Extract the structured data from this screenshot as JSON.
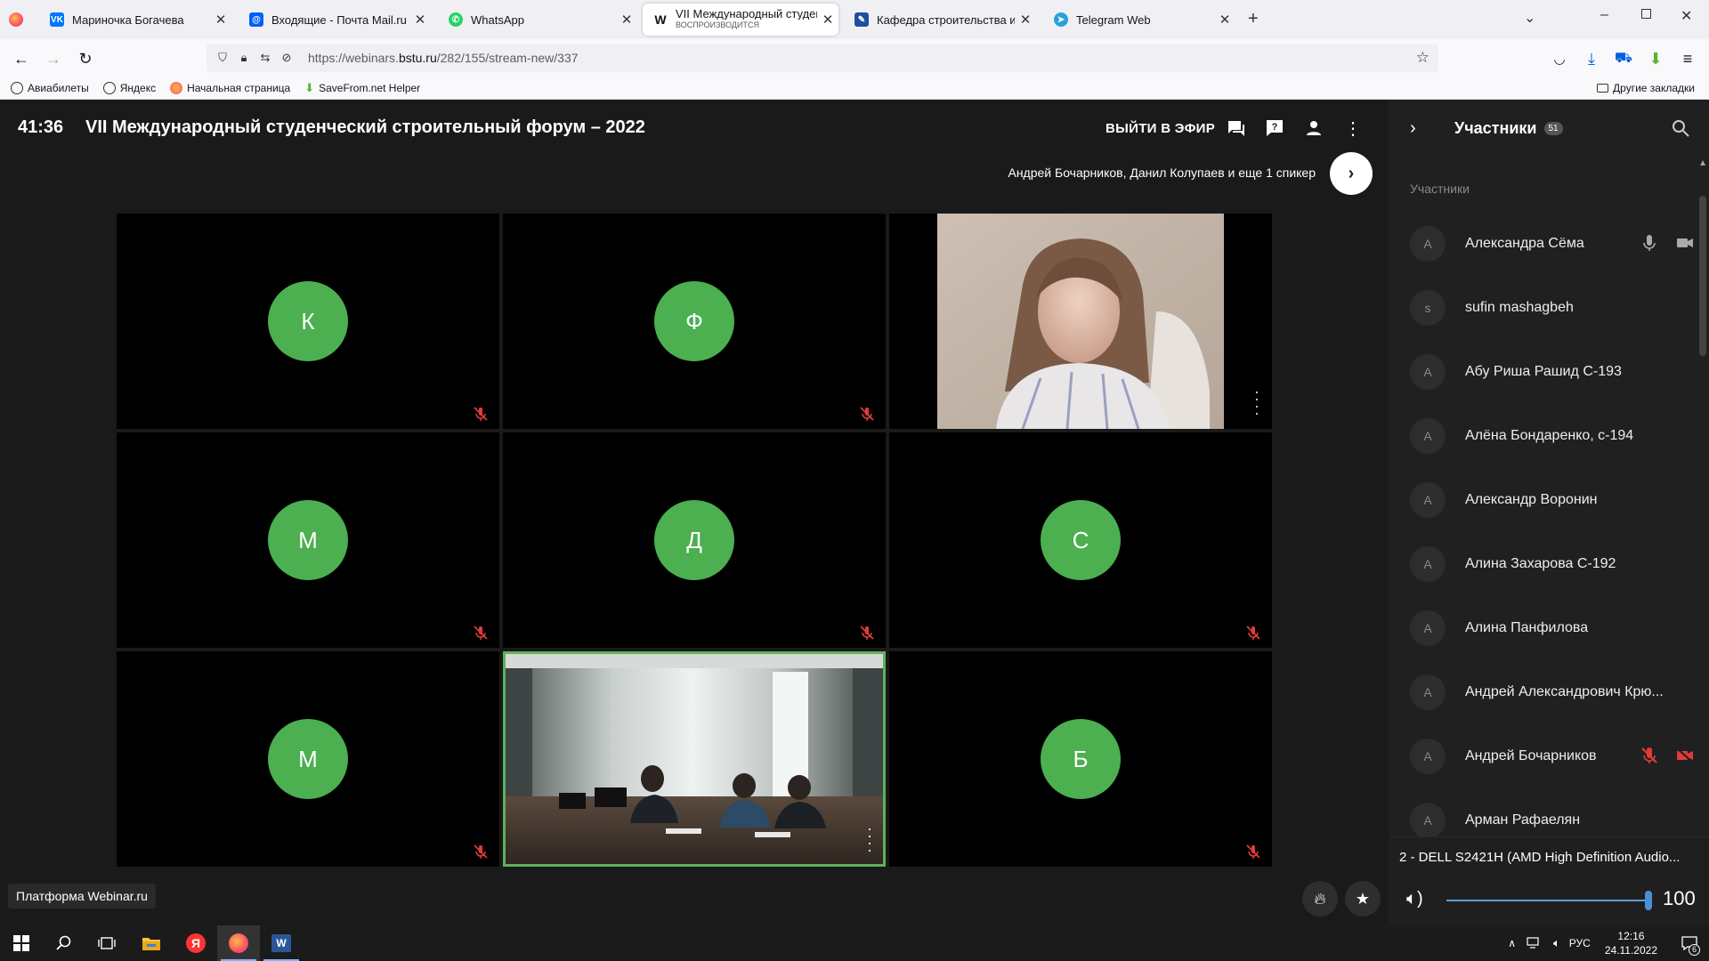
{
  "browser": {
    "tabs": [
      {
        "title": "Мариночка Богачева",
        "icon": "vk-icon",
        "color": "#0077ff"
      },
      {
        "title": "Входящие - Почта Mail.ru",
        "icon": "mail-icon",
        "color": "#005ff9"
      },
      {
        "title": "WhatsApp",
        "icon": "whatsapp-icon",
        "color": "#25d366"
      },
      {
        "title": "VII Международный студенчес",
        "subtitle": "ВОСПРОИЗВОДИТСЯ",
        "icon": "webinar-icon",
        "color": "#222222"
      },
      {
        "title": "Кафедра строительства и горо",
        "icon": "site-icon",
        "color": "#1d4fa0"
      },
      {
        "title": "Telegram Web",
        "icon": "telegram-icon",
        "color": "#2aa1da"
      }
    ],
    "url_prefix": "https://webinars.",
    "url_domain": "bstu.ru",
    "url_path": "/282/155/stream-new/337",
    "bookmarks": [
      "Авиабилеты",
      "Яндекс",
      "Начальная страница",
      "SaveFrom.net Helper"
    ],
    "other_bookmarks": "Другие закладки"
  },
  "webinar": {
    "timer": "41:36",
    "title": "VII Международный студенческий строительный форум – 2022",
    "go_live": "ВЫЙТИ В ЭФИР",
    "speakers": "Андрей Бочарников, Данил Колупаев и еще 1 спикер",
    "tiles": [
      {
        "type": "avatar",
        "letter": "К",
        "muted": true
      },
      {
        "type": "avatar",
        "letter": "Ф",
        "muted": true
      },
      {
        "type": "video",
        "scene": "woman",
        "muted": false
      },
      {
        "type": "avatar",
        "letter": "М",
        "muted": true
      },
      {
        "type": "avatar",
        "letter": "Д",
        "muted": true
      },
      {
        "type": "avatar",
        "letter": "С",
        "muted": true
      },
      {
        "type": "avatar",
        "letter": "М",
        "muted": true
      },
      {
        "type": "video",
        "scene": "room",
        "muted": false,
        "active": true
      },
      {
        "type": "avatar",
        "letter": "Б",
        "muted": true
      }
    ],
    "brand": "Платформа Webinar.ru",
    "accent": "#4caf50"
  },
  "participants": {
    "title": "Участники",
    "count": "51",
    "section": "Участники",
    "list": [
      {
        "initial": "А",
        "name": "Александра Сёма",
        "mic": "on",
        "cam": "on"
      },
      {
        "initial": "s",
        "name": "sufin mashagbeh"
      },
      {
        "initial": "А",
        "name": "Абу Риша Рашид С-193"
      },
      {
        "initial": "А",
        "name": "Алёна Бондаренко, с-194"
      },
      {
        "initial": "А",
        "name": "Александр Воронин"
      },
      {
        "initial": "А",
        "name": "Алина Захарова С-192"
      },
      {
        "initial": "А",
        "name": "Алина Панфилова"
      },
      {
        "initial": "А",
        "name": "Андрей Александрович Крю..."
      },
      {
        "initial": "А",
        "name": "Андрей Бочарников",
        "mic": "off",
        "cam": "off"
      },
      {
        "initial": "А",
        "name": "Арман Рафаелян"
      }
    ]
  },
  "volume": {
    "device": "2 - DELL S2421H (AMD High Definition Audio...",
    "level": "100"
  },
  "taskbar": {
    "lang": "РУС",
    "time": "12:16",
    "date": "24.11.2022",
    "notifications": "6"
  }
}
